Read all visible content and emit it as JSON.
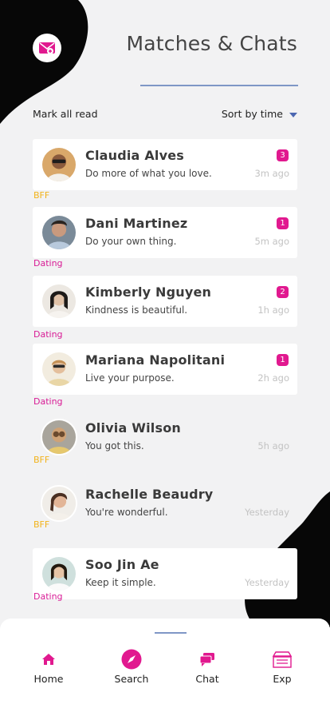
{
  "header": {
    "title": "Matches & Chats",
    "mark_all_read": "Mark all read",
    "sort_label": "Sort by time"
  },
  "colors": {
    "accent_pink": "#e1198f",
    "tag_bff": "#f2b31c",
    "tag_dating": "#d81b95",
    "rule_blue": "#7f97c6"
  },
  "chats": [
    {
      "name": "Claudia Alves",
      "preview": "Do more of what you love.",
      "time": "3m ago",
      "unread": "3",
      "tag": "BFF"
    },
    {
      "name": "Dani Martinez",
      "preview": "Do your own thing.",
      "time": "5m ago",
      "unread": "1",
      "tag": "Dating"
    },
    {
      "name": "Kimberly Nguyen",
      "preview": "Kindness is beautiful.",
      "time": "1h ago",
      "unread": "2",
      "tag": "Dating"
    },
    {
      "name": "Mariana Napolitani",
      "preview": "Live your purpose.",
      "time": "2h ago",
      "unread": "1",
      "tag": "Dating"
    },
    {
      "name": "Olivia Wilson",
      "preview": "You got this.",
      "time": "5h ago",
      "unread": null,
      "tag": "BFF"
    },
    {
      "name": "Rachelle Beaudry",
      "preview": "You're wonderful.",
      "time": "Yesterday",
      "unread": null,
      "tag": "BFF"
    },
    {
      "name": "Soo Jin Ae",
      "preview": "Keep it simple.",
      "time": "Yesterday",
      "unread": null,
      "tag": "Dating"
    }
  ],
  "nav": {
    "home": "Home",
    "search": "Search",
    "chat": "Chat",
    "exp": "Exp"
  },
  "icons": {
    "header": "mail-plus-icon",
    "sort": "caret-down-icon",
    "nav_home": "home-icon",
    "nav_search": "compass-icon",
    "nav_chat": "chat-bubbles-icon",
    "nav_exp": "ticket-icon"
  }
}
